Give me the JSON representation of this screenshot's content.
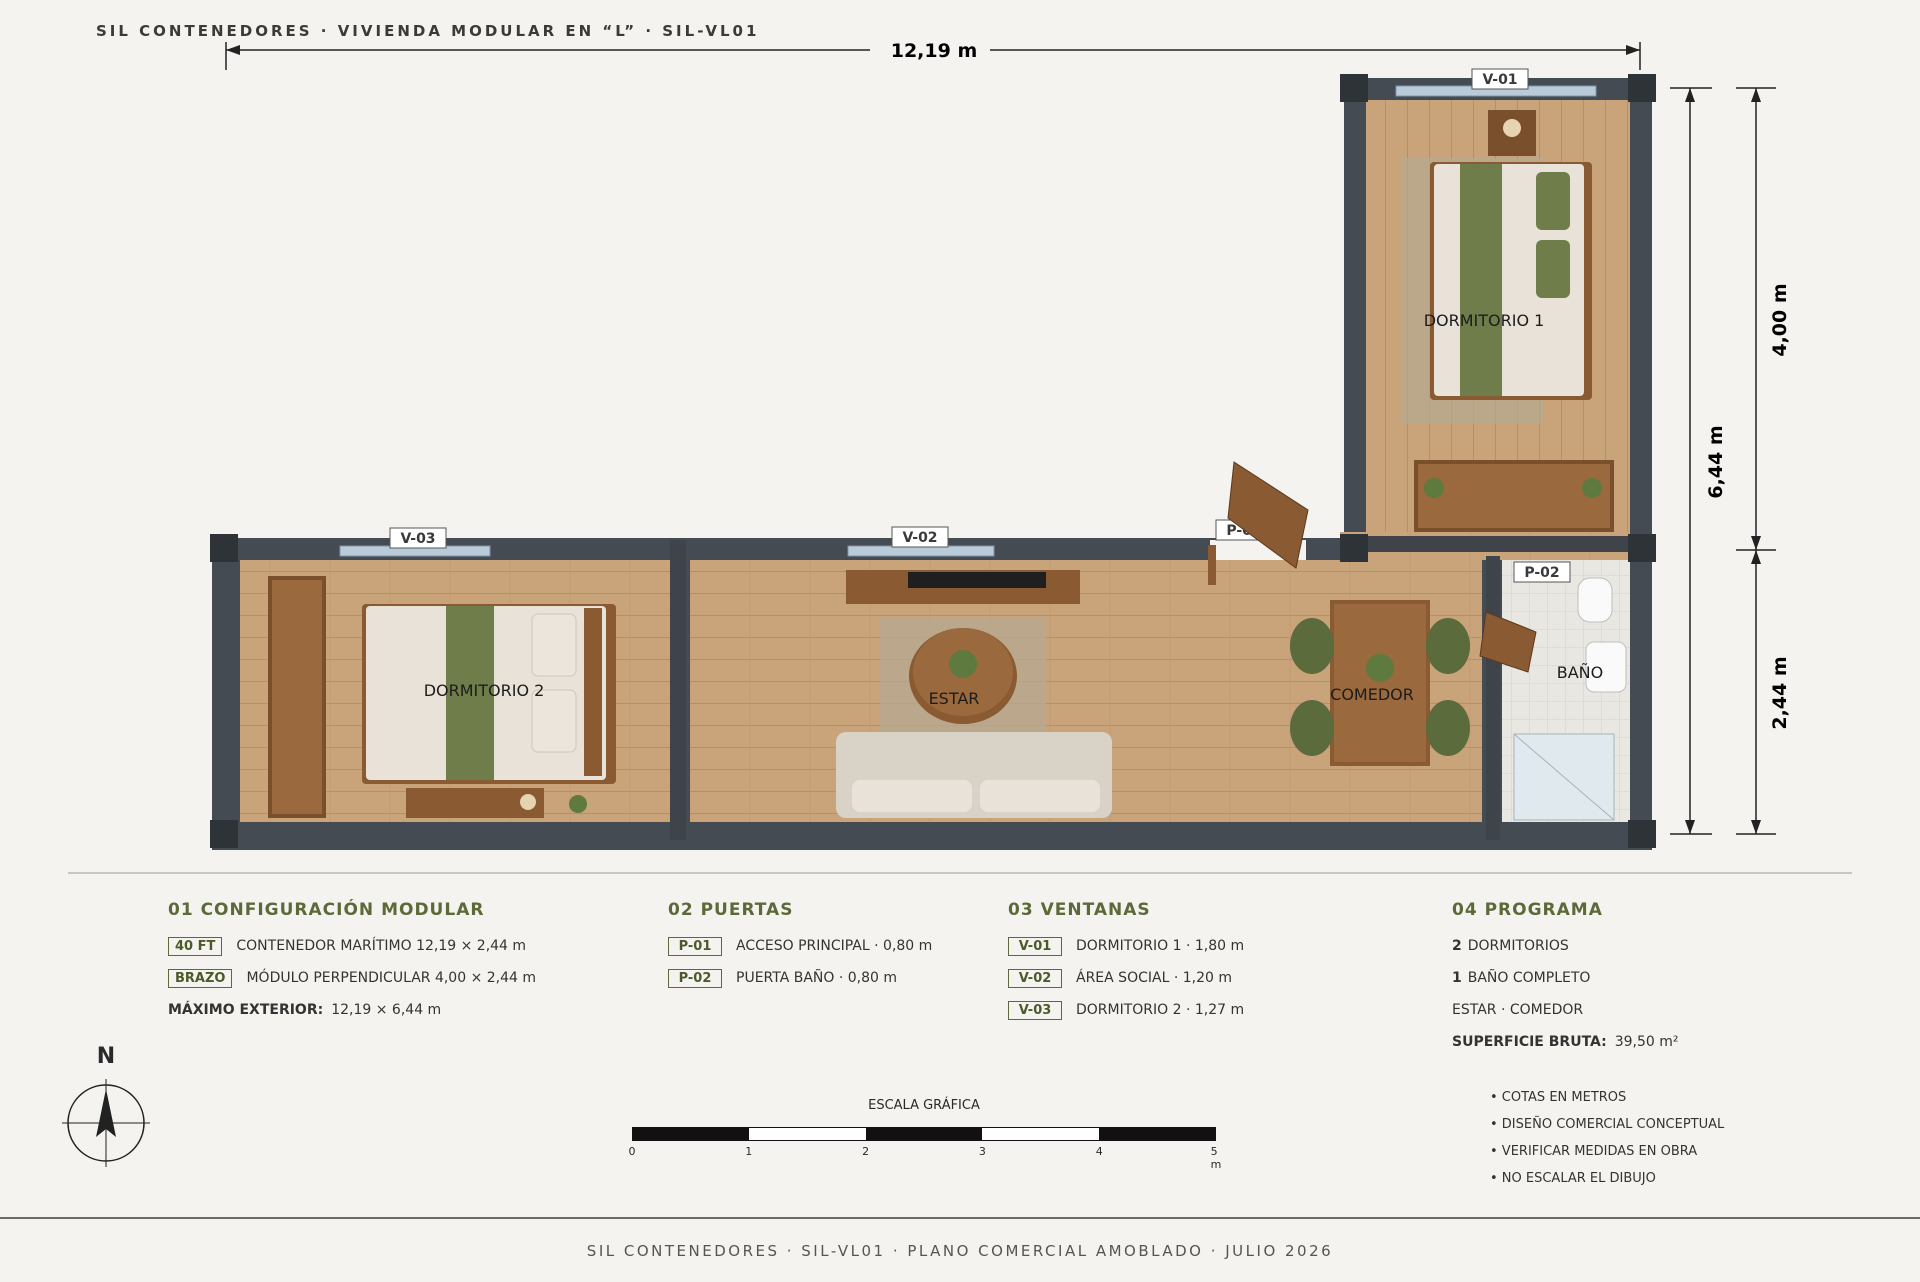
{
  "header": {
    "title": "SIL CONTENEDORES · VIVIENDA MODULAR EN “L” · SIL-VL01"
  },
  "dimensions": {
    "total_width": "12,19 m",
    "total_depth": "6,44 m",
    "arm_depth": "4,00 m",
    "module_width": "2,44 m"
  },
  "rooms": {
    "dormitorio1": "DORMITORIO 1",
    "dormitorio2": "DORMITORIO 2",
    "estar": "ESTAR",
    "comedor": "COMEDOR",
    "bano": "BAÑO"
  },
  "openings": {
    "v01": "V-01",
    "v02": "V-02",
    "v03": "V-03",
    "p01": "P-01",
    "p02": "P-02"
  },
  "sections": {
    "config": {
      "title": "01 CONFIGURACIÓN MODULAR",
      "rows": [
        {
          "tag": "40 FT",
          "text": "CONTENEDOR MARÍTIMO 12,19 × 2,44 m"
        },
        {
          "tag": "BRAZO",
          "text": "MÓDULO PERPENDICULAR 4,00 × 2,44 m"
        }
      ],
      "max_label": "MÁXIMO EXTERIOR:",
      "max_value": "12,19 × 6,44 m"
    },
    "doors": {
      "title": "02 PUERTAS",
      "rows": [
        {
          "tag": "P-01",
          "text": "ACCESO PRINCIPAL · 0,80 m"
        },
        {
          "tag": "P-02",
          "text": "PUERTA BAÑO · 0,80 m"
        }
      ]
    },
    "windows": {
      "title": "03 VENTANAS",
      "rows": [
        {
          "tag": "V-01",
          "text": "DORMITORIO 1 · 1,80 m"
        },
        {
          "tag": "V-02",
          "text": "ÁREA SOCIAL · 1,20 m"
        },
        {
          "tag": "V-03",
          "text": "DORMITORIO 2 · 1,27 m"
        }
      ]
    },
    "program": {
      "title": "04 PROGRAMA",
      "line1_num": "2",
      "line1_text": "DORMITORIOS",
      "line2_num": "1",
      "line2_text": "BAÑO COMPLETO",
      "line3": "ESTAR · COMEDOR",
      "area_label": "SUPERFICIE BRUTA:",
      "area_value": "39,50 m²"
    }
  },
  "notes": [
    "• COTAS EN METROS",
    "• DISEÑO COMERCIAL CONCEPTUAL",
    "• VERIFICAR MEDIDAS EN OBRA",
    "• NO ESCALAR EL DIBUJO"
  ],
  "north": "N",
  "scale": {
    "title": "ESCALA GRÁFICA",
    "ticks": [
      "0",
      "1",
      "2",
      "3",
      "4",
      "5 m"
    ]
  },
  "footer": {
    "text": "SIL CONTENEDORES · SIL-VL01 · PLANO COMERCIAL AMOBLADO · JULIO 2026"
  },
  "colors": {
    "wall": "#454b52",
    "floor": "#c9a47b",
    "olive": "#6a7a48",
    "accent_text": "#5c6a3a"
  }
}
